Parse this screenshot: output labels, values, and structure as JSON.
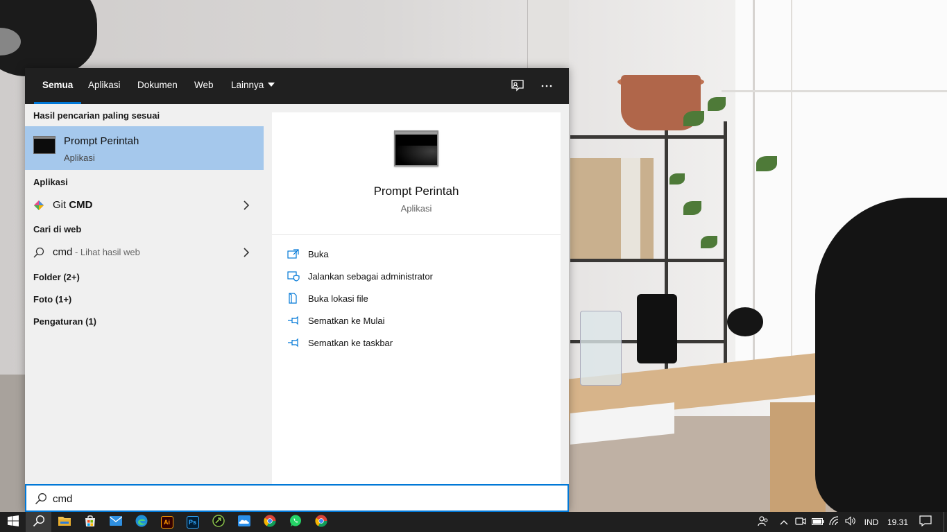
{
  "tabs": [
    {
      "label": "Semua",
      "active": true
    },
    {
      "label": "Aplikasi"
    },
    {
      "label": "Dokumen"
    },
    {
      "label": "Web"
    },
    {
      "label": "Lainnya"
    }
  ],
  "topbar_icons": [
    "feedback-icon",
    "more-options-icon"
  ],
  "results": {
    "best_match_heading": "Hasil pencarian paling sesuai",
    "best_match": {
      "title": "Prompt Perintah",
      "subtitle": "Aplikasi",
      "icon": "command-prompt-icon"
    },
    "apps_heading": "Aplikasi",
    "apps": [
      {
        "prefix": "Git ",
        "match": "CMD",
        "icon": "git-icon"
      }
    ],
    "web_heading": "Cari di web",
    "web": {
      "query": "cmd",
      "suffix": " - Lihat hasil web",
      "icon": "search-icon"
    },
    "categories": [
      "Folder (2+)",
      "Foto (1+)",
      "Pengaturan (1)"
    ]
  },
  "preview": {
    "title": "Prompt Perintah",
    "subtitle": "Aplikasi",
    "actions": [
      {
        "label": "Buka",
        "icon": "open-icon"
      },
      {
        "label": "Jalankan sebagai administrator",
        "icon": "run-as-admin-icon"
      },
      {
        "label": "Buka lokasi file",
        "icon": "file-location-icon"
      },
      {
        "label": "Sematkan ke Mulai",
        "icon": "pin-icon"
      },
      {
        "label": "Sematkan ke taskbar",
        "icon": "pin-icon"
      }
    ]
  },
  "search": {
    "value": "cmd",
    "placeholder": ""
  },
  "taskbar": {
    "apps": [
      "start-icon",
      "search-icon",
      "file-explorer-icon",
      "store-icon",
      "mail-icon",
      "edge-icon",
      "illustrator-icon",
      "photoshop-icon",
      "app-icon",
      "onedrive-icon",
      "chrome-icon",
      "whatsapp-icon",
      "chrome-icon"
    ],
    "app_labels": {
      "illustrator": "Ai",
      "photoshop": "Ps"
    },
    "tray": {
      "language": "IND",
      "time": "19.31"
    }
  },
  "colors": {
    "accent": "#0078d7",
    "selection": "#a5c8ec",
    "topbar": "#202020",
    "taskbar": "#1f1f1f"
  }
}
